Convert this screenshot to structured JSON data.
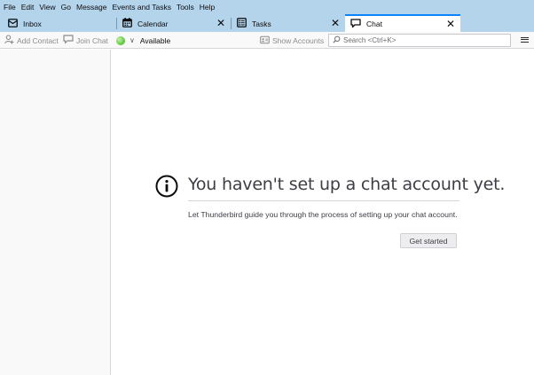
{
  "menubar": {
    "items": [
      "File",
      "Edit",
      "View",
      "Go",
      "Message",
      "Events and Tasks",
      "Tools",
      "Help"
    ]
  },
  "tabs": [
    {
      "label": "Inbox",
      "icon": "mail-icon",
      "closable": false,
      "selected": false
    },
    {
      "label": "Calendar",
      "icon": "calendar-icon",
      "closable": true,
      "selected": false
    },
    {
      "label": "Tasks",
      "icon": "tasks-icon",
      "closable": true,
      "selected": false
    },
    {
      "label": "Chat",
      "icon": "chat-icon",
      "closable": true,
      "selected": true
    }
  ],
  "tab_close_glyph": "✕",
  "toolbar": {
    "add_contact_label": "Add Contact",
    "join_chat_label": "Join Chat",
    "status_label": "Available",
    "status_chevron": "∨",
    "show_accounts_label": "Show Accounts",
    "search_placeholder": "Search <Ctrl+K>"
  },
  "main": {
    "heading": "You haven't set up a chat account yet.",
    "description": "Let Thunderbird guide you through the process of setting up your chat account.",
    "get_started_label": "Get started"
  },
  "colors": {
    "titlebar": "#b4d4ec",
    "tab_accent": "#0a84ff",
    "status_available": "#6ccf4a",
    "toolbar_bg": "#f9f9fa",
    "pane_border": "#d7d7db"
  }
}
